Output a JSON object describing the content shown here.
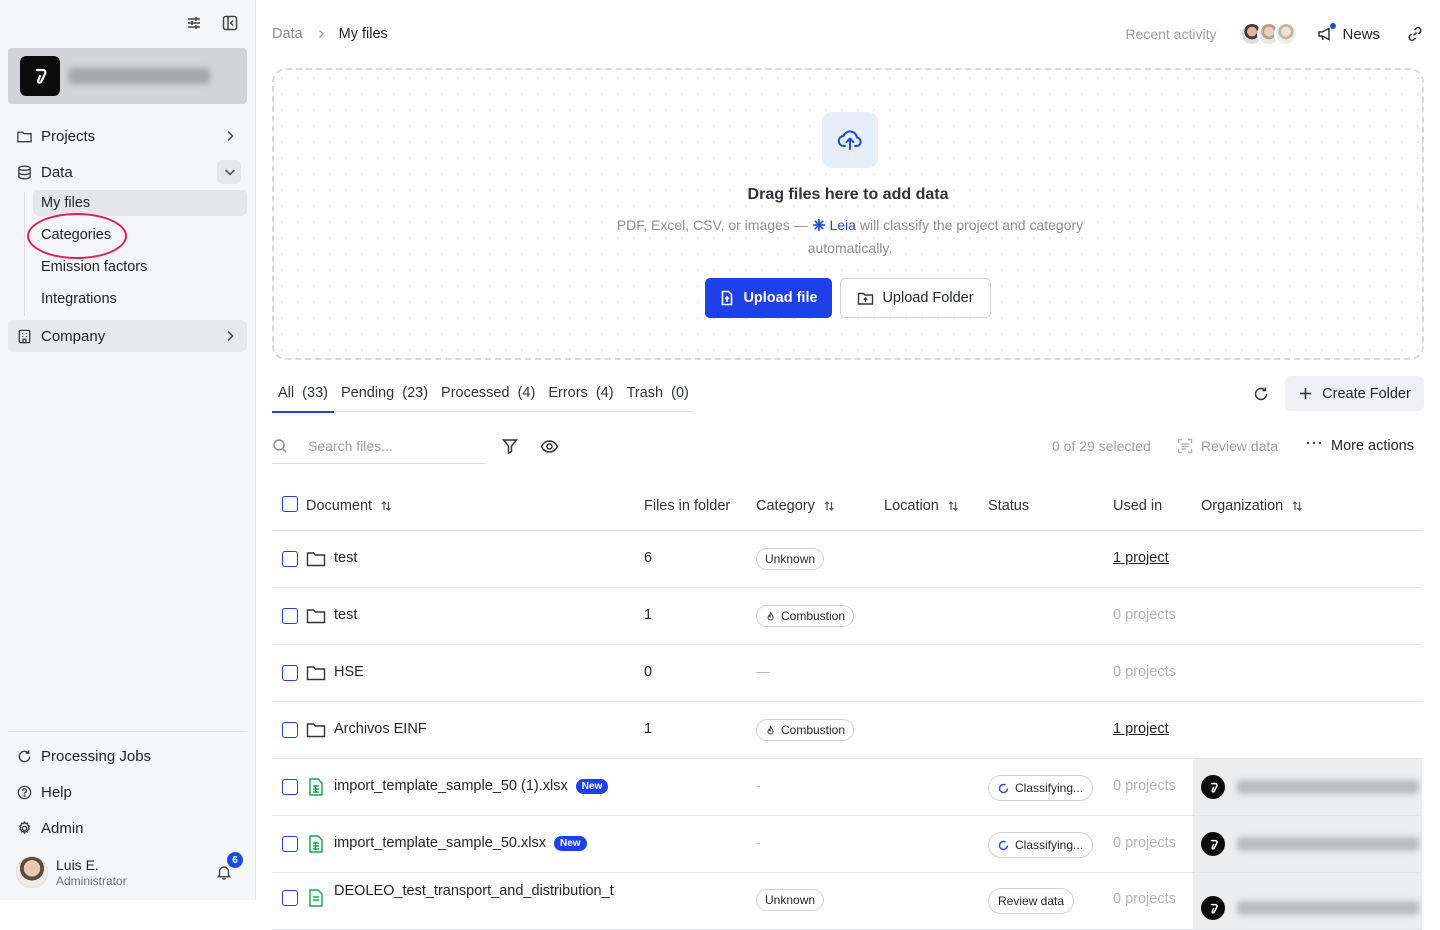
{
  "sidebar": {
    "nav": {
      "projects": "Projects",
      "data": "Data",
      "company": "Company"
    },
    "sub_items": {
      "my_files": "My files",
      "categories": "Categories",
      "emission_factors": "Emission factors",
      "integrations": "Integrations"
    },
    "bottom": {
      "processing_jobs": "Processing Jobs",
      "help": "Help",
      "admin": "Admin"
    },
    "user": {
      "name": "Luis E.",
      "role": "Administrator",
      "notifications": "6"
    }
  },
  "header": {
    "breadcrumb_root": "Data",
    "breadcrumb_current": "My files",
    "recent_activity": "Recent activity",
    "news": "News"
  },
  "dropzone": {
    "title": "Drag files here to add data",
    "subtitle_before": "PDF, Excel, CSV, or images —",
    "leia": "Leia",
    "subtitle_after": "will classify the project and category automatically.",
    "upload_file": "Upload file",
    "upload_folder": "Upload Folder"
  },
  "tabs": {
    "all": "All  (33)",
    "pending": "Pending  (23)",
    "processed": "Processed  (4)",
    "errors": "Errors  (4)",
    "trash": "Trash  (0)"
  },
  "toolbar": {
    "create_folder": "Create Folder",
    "search_placeholder": "Search files...",
    "selected_count": "0 of 29 selected",
    "review_data": "Review data",
    "more_actions": "More actions"
  },
  "table": {
    "columns": {
      "document": "Document",
      "files_in_folder": "Files in folder",
      "category": "Category",
      "location": "Location",
      "status": "Status",
      "used_in": "Used in",
      "organization": "Organization"
    },
    "rows": [
      {
        "name": "test",
        "files": "6",
        "category": "Unknown",
        "used_in": "1 project"
      },
      {
        "name": "test",
        "files": "1",
        "category": "Combustion",
        "used_in": "0 projects"
      },
      {
        "name": "HSE",
        "files": "0",
        "category": "—",
        "used_in": "0 projects"
      },
      {
        "name": "Archivos EINF",
        "files": "1",
        "category": "Combustion",
        "used_in": "1 project"
      },
      {
        "name": "import_template_sample_50 (1).xlsx",
        "badge": "New",
        "category": "-",
        "status": "Classifying...",
        "used_in": "0 projects"
      },
      {
        "name": "import_template_sample_50.xlsx",
        "badge": "New",
        "category": "-",
        "status": "Classifying...",
        "used_in": "0 projects"
      },
      {
        "name": "DEOLEO_test_transport_and_distribution_t",
        "category": "Unknown",
        "status": "Review data",
        "used_in": "0 projects"
      }
    ]
  },
  "colors": {
    "accent": "#1e40e8",
    "annotation": "#e01e5a"
  }
}
